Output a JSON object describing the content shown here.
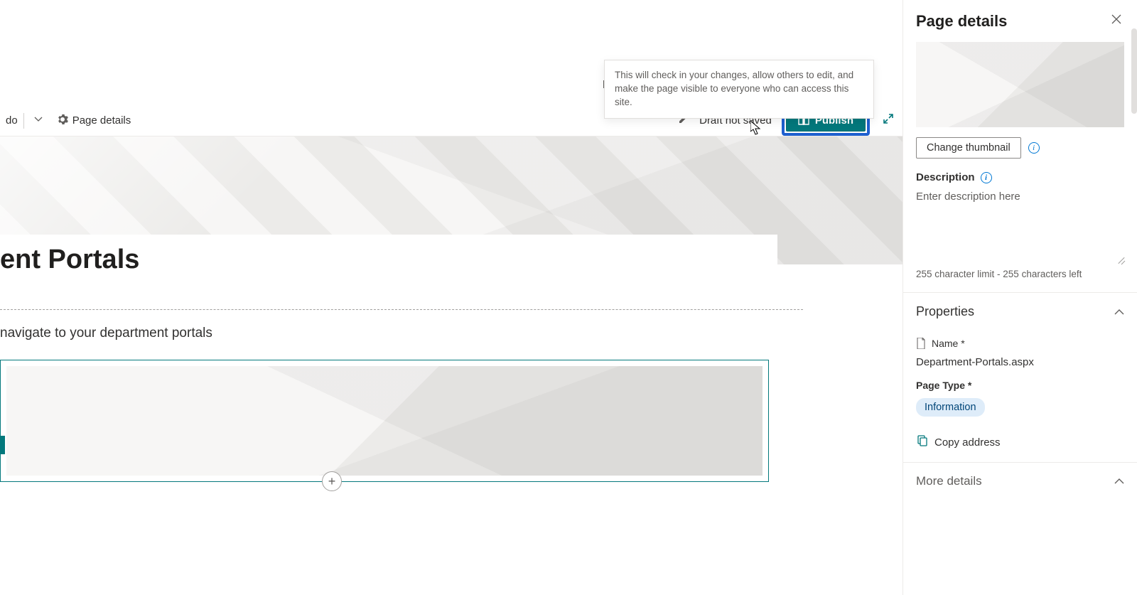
{
  "commandBar": {
    "undo_suffix": "do",
    "page_details_label": "Page details",
    "draft_status": "Draft not saved",
    "publish_label": "Publish"
  },
  "tooltip": {
    "text": "This will check in your changes, allow others to edit, and make the page visible to everyone who can access this site.",
    "trail_letter": "p"
  },
  "page": {
    "title_visible": "ent Portals",
    "subtitle_visible": "navigate to your department portals"
  },
  "panel": {
    "header": "Page details",
    "change_thumbnail": "Change thumbnail",
    "description_label": "Description",
    "description_placeholder": "Enter description here",
    "char_limit": "255 character limit - 255 characters left",
    "properties_label": "Properties",
    "name_label": "Name *",
    "name_value": "Department-Portals.aspx",
    "page_type_label": "Page Type *",
    "page_type_value": "Information",
    "copy_address": "Copy address",
    "more_details": "More details"
  }
}
